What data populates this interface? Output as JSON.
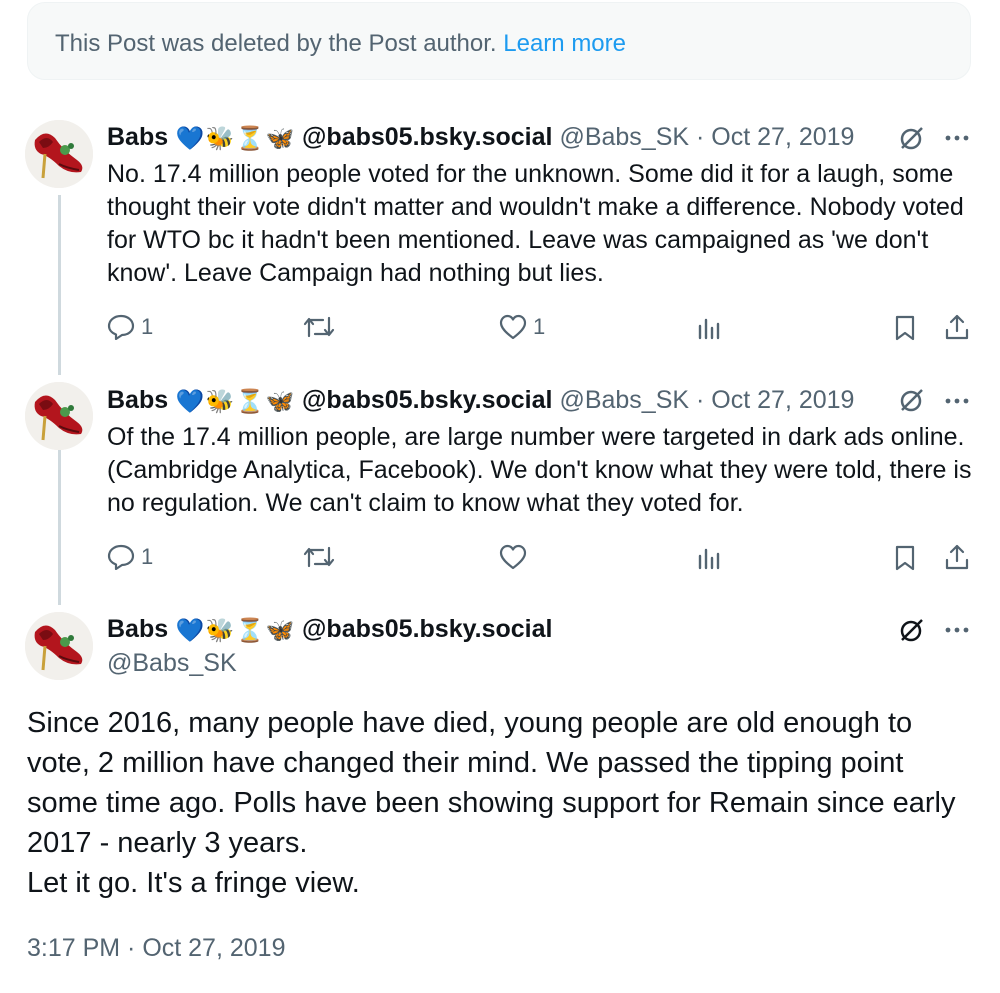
{
  "notice": {
    "text": "This Post was deleted by the Post author.",
    "link": "Learn more"
  },
  "author": {
    "name": "Babs",
    "emojis": [
      "💙",
      "🐝",
      "⏳",
      "🦋"
    ],
    "bsky": "@babs05.bsky.social",
    "handle": "@Babs_SK"
  },
  "replies": [
    {
      "date": "Oct 27, 2019",
      "text": "No. 17.4 million people voted for the unknown. Some did it for a laugh, some thought their vote didn't matter and wouldn't make a difference. Nobody voted for WTO bc it hadn't been mentioned. Leave was campaigned as 'we don't know'. Leave Campaign had nothing but lies.",
      "reply_count": "1",
      "like_count": "1"
    },
    {
      "date": "Oct 27, 2019",
      "text": "Of the 17.4 million people, are large number were targeted in dark ads online. (Cambridge Analytica, Facebook). We don't know what they were told, there is no regulation. We can't claim to know what they voted for.",
      "reply_count": "1",
      "like_count": ""
    }
  ],
  "main_post": {
    "paragraphs": [
      "Since 2016, many people have died, young people are old enough to vote, 2 million have changed their mind. We passed the tipping point some time ago. Polls have been showing support for Remain since early 2017 - nearly 3 years.",
      "Let it go. It's a fringe view."
    ],
    "timestamp": "3:17 PM · Oct 27, 2019"
  },
  "separator": "·",
  "colors": {
    "link": "#1d9bf0",
    "secondary_text": "#536471",
    "thread_line": "#cfd9de"
  },
  "icons": [
    "reply-icon",
    "repost-icon",
    "like-icon",
    "views-icon",
    "bookmark-icon",
    "share-icon",
    "grok-icon",
    "more-icon"
  ]
}
